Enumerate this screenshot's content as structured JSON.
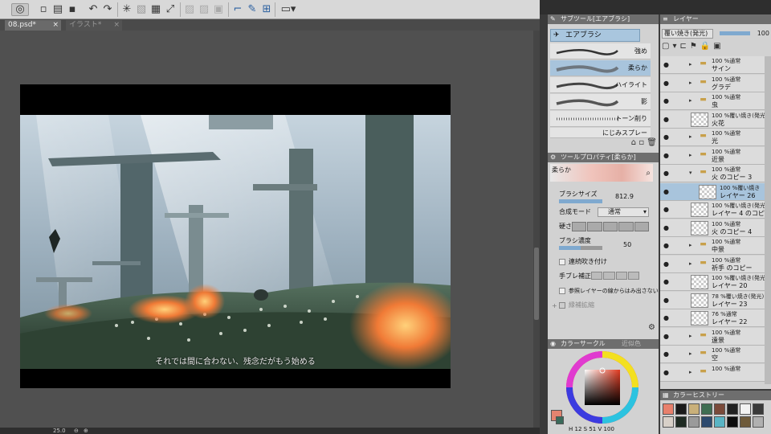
{
  "tabs": [
    {
      "label": "08.psd*",
      "close": "×"
    },
    {
      "label": "イラスト*",
      "close": "×"
    }
  ],
  "artwork": {
    "subtitle": "それでは間に合わない、残念だがもう始める"
  },
  "status": {
    "zoom": "25.0"
  },
  "subtool_panel": {
    "title": "サブツール[エアブラシ]",
    "active_tool": "エアブラシ",
    "brushes": [
      {
        "label": "強め"
      },
      {
        "label": "柔らか"
      },
      {
        "label": "ハイライト"
      },
      {
        "label": "影"
      },
      {
        "label": "トーン削り"
      },
      {
        "label": "にじみスプレー"
      }
    ]
  },
  "tool_property": {
    "title": "ツールプロパティ[柔らか]",
    "preview_label": "柔らか",
    "brush_size_label": "ブラシサイズ",
    "brush_size_value": "812.9",
    "blend_mode_label": "合成モード",
    "blend_mode_value": "通常",
    "hardness_label": "硬さ",
    "brush_density_label": "ブラシ濃度",
    "brush_density_value": "50",
    "continuous_label": "連続吹き付け",
    "stabilization_label": "手ブレ補正",
    "reference_layer_label": "参照レイヤーの線からはみ出さない",
    "expand_label": "縁補拡縮"
  },
  "color_panel": {
    "title": "カラーサークル",
    "tab2": "近似色",
    "h_value": "12",
    "s_value": "51",
    "v_value": "100",
    "current_color": "#e38470"
  },
  "layer_panel": {
    "title": "レイヤー",
    "blend_mode": "覆い焼き(発光)",
    "opacity": "100",
    "layers": [
      {
        "line1": "100 %通常",
        "line2": "サイン",
        "kind": "folder",
        "selected": false
      },
      {
        "line1": "100 %通常",
        "line2": "グラデ",
        "kind": "folder",
        "selected": false
      },
      {
        "line1": "100 %通常",
        "line2": "虫",
        "kind": "folder",
        "selected": false
      },
      {
        "line1": "100 %覆い焼き(発光)",
        "line2": "火花",
        "kind": "raster",
        "selected": false
      },
      {
        "line1": "100 %通常",
        "line2": "光",
        "kind": "folder",
        "selected": false
      },
      {
        "line1": "100 %通常",
        "line2": "近景",
        "kind": "folder",
        "selected": false
      },
      {
        "line1": "100 %通常",
        "line2": "火 のコピー 3",
        "kind": "folder-open",
        "selected": false
      },
      {
        "line1": "100 %覆い焼き",
        "line2": "レイヤー 26",
        "kind": "raster",
        "selected": true
      },
      {
        "line1": "100 %覆い焼き(発光)",
        "line2": "レイヤー 4 のコピ",
        "kind": "raster",
        "selected": false
      },
      {
        "line1": "100 %通常",
        "line2": "火 のコピー 4",
        "kind": "raster",
        "selected": false
      },
      {
        "line1": "100 %通常",
        "line2": "中景",
        "kind": "folder",
        "selected": false
      },
      {
        "line1": "100 %通常",
        "line2": "祈手 のコピー",
        "kind": "folder",
        "selected": false
      },
      {
        "line1": "100 %覆い焼き(発光)",
        "line2": "レイヤー 20",
        "kind": "raster",
        "selected": false
      },
      {
        "line1": "78 %覆い焼き(発光)",
        "line2": "レイヤー 23",
        "kind": "raster",
        "selected": false
      },
      {
        "line1": "76 %通常",
        "line2": "レイヤー 22",
        "kind": "raster",
        "selected": false
      },
      {
        "line1": "100 %通常",
        "line2": "遠景",
        "kind": "folder",
        "selected": false
      },
      {
        "line1": "100 %通常",
        "line2": "空",
        "kind": "folder",
        "selected": false
      },
      {
        "line1": "100 %通常",
        "line2": "",
        "kind": "folder",
        "selected": false
      }
    ]
  },
  "history_panel": {
    "title": "カラーヒストリー",
    "swatches": [
      "#e8806c",
      "#1a1a1a",
      "#c9b07a",
      "#3f6e52",
      "#7a4a3a",
      "#222222",
      "#f2f2f2",
      "#3a3a3a",
      "#d8d0c8",
      "#1e2a22",
      "#9a9a9a",
      "#2d4a6e",
      "#5ab4c4",
      "#0d0d0d",
      "#6e5a3a",
      "#b0b0b0"
    ]
  }
}
